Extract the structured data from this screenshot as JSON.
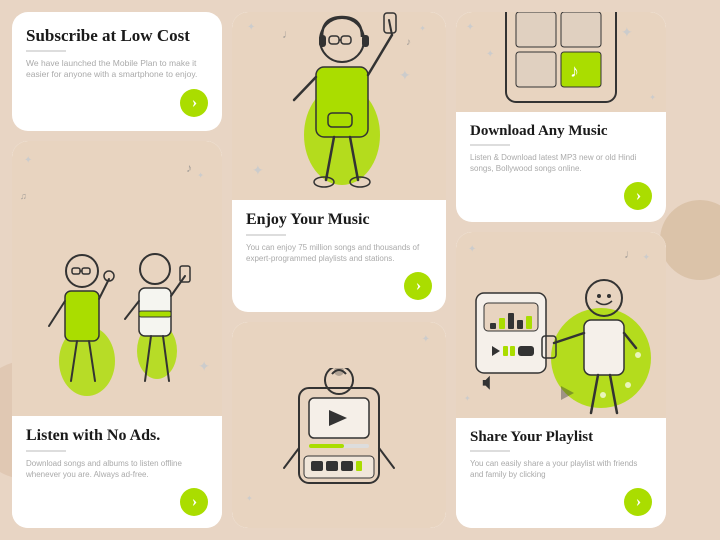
{
  "colors": {
    "bg": "#e8d5c4",
    "card": "#ffffff",
    "illus_bg": "#e8d4c0",
    "green": "#a8d800",
    "text_dark": "#1a1a1a",
    "text_gray": "#999999"
  },
  "cards": {
    "subscribe": {
      "title": "Subscribe at Low Cost",
      "description": "We have launched the Mobile Plan to make it easier for anyone with a smartphone to enjoy.",
      "btn_label": "›"
    },
    "listen": {
      "title": "Listen with No Ads.",
      "description": "Download songs and albums to listen offline whenever you are. Always ad-free.",
      "btn_label": "›"
    },
    "enjoy": {
      "title": "Enjoy Your Music",
      "description": "You can enjoy 75 million songs and thousands of expert-programmed playlists and stations.",
      "btn_label": "›"
    },
    "video": {
      "title": "",
      "description": ""
    },
    "download": {
      "title": "Download Any Music",
      "description": "Listen & Download latest MP3 new or old Hindi songs, Bollywood songs online.",
      "btn_label": "›"
    },
    "share": {
      "title": "Share Your Playlist",
      "description": "You can easily share a your playlist with friends and family by clicking",
      "btn_label": "›"
    }
  }
}
